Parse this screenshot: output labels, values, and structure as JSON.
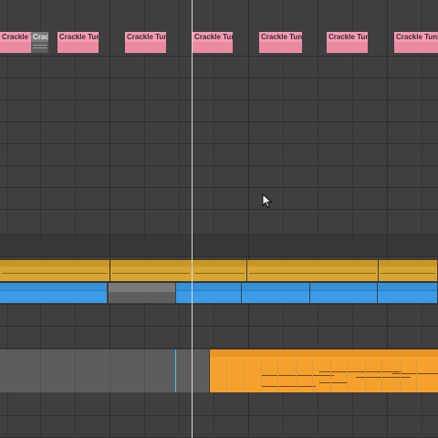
{
  "arrangement": {
    "clip_name": "Crackle Tunin",
    "clip_name_short": "Crac",
    "colors": {
      "track_bg": "#3f3f3f",
      "pink_clip": "#f39bb1",
      "gold_clip": "#d6a533",
      "blue_clip": "#3b9be6",
      "gray_clip": "#6a6a6a",
      "orange_clip": "#f5a12e",
      "insert_marker": "#d8d8d8"
    },
    "icons": {
      "mouse_pointer": "arrow-cursor-icon"
    }
  }
}
